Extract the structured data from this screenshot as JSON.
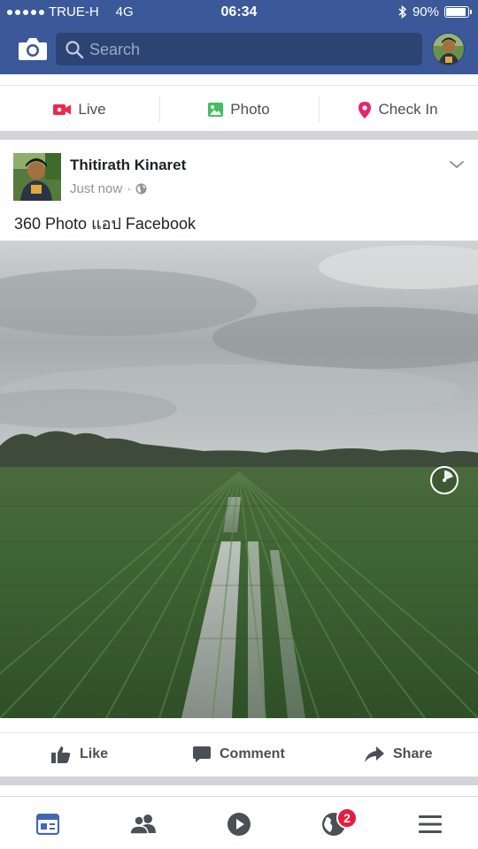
{
  "status_bar": {
    "carrier": "TRUE-H",
    "network": "4G",
    "time": "06:34",
    "battery": "90%",
    "battery_level": 0.9
  },
  "header": {
    "search_placeholder": "Search",
    "icons": [
      "camera-icon",
      "search-icon"
    ]
  },
  "composer": {
    "live_label": "Live",
    "photo_label": "Photo",
    "checkin_label": "Check In",
    "colors": {
      "live": "#f02849",
      "photo": "#45bd62",
      "checkin": "#e4266f"
    }
  },
  "post": {
    "author": "Thitirath Kinaret",
    "timestamp": "Just now",
    "separator": "·",
    "privacy": "public-globe-icon",
    "text": "360 Photo แอป Facebook"
  },
  "actions": {
    "like_label": "Like",
    "comment_label": "Comment",
    "share_label": "Share"
  },
  "bottom_nav": {
    "items": [
      "news-feed-icon",
      "friends-icon",
      "watch-icon",
      "notifications-globe-icon",
      "menu-icon"
    ],
    "notification_count": "2"
  },
  "colors": {
    "brand": "#3b5998",
    "badge": "#e41e3f"
  }
}
